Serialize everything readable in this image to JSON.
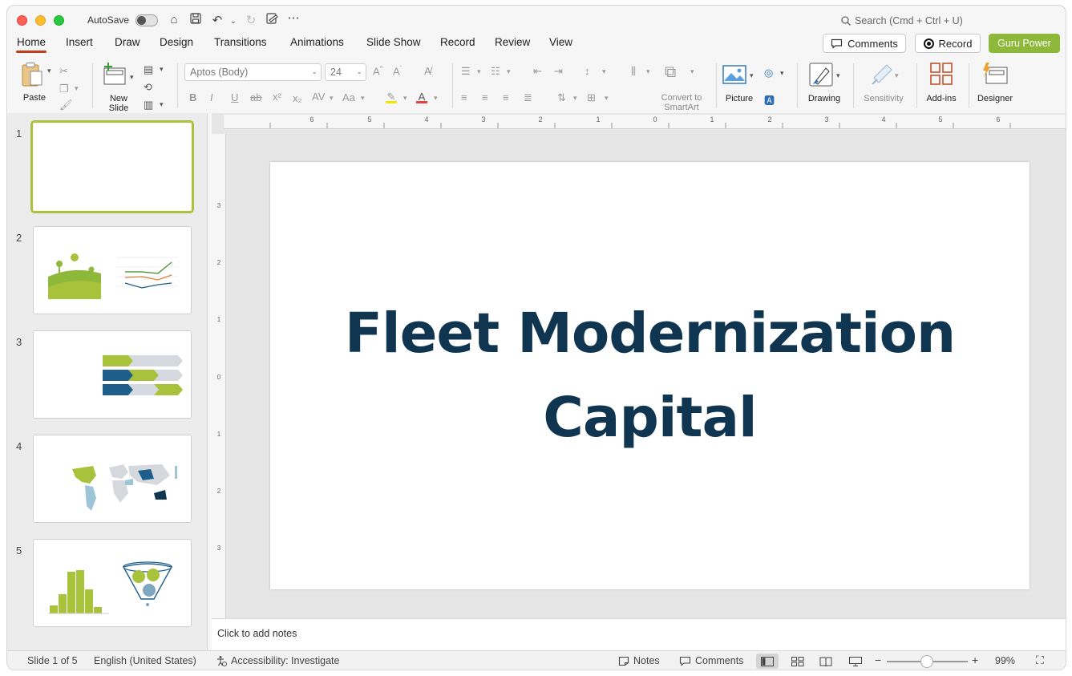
{
  "titlebar": {
    "autosave_label": "AutoSave",
    "search_placeholder": "Search (Cmd + Ctrl + U)"
  },
  "tabs": [
    "Home",
    "Insert",
    "Draw",
    "Design",
    "Transitions",
    "Animations",
    "Slide Show",
    "Record",
    "Review",
    "View"
  ],
  "header_buttons": {
    "comments": "Comments",
    "record": "Record",
    "guru": "Guru Power"
  },
  "ribbon": {
    "paste": "Paste",
    "new_slide": "New\nSlide",
    "font_name": "Aptos (Body)",
    "font_size": "24",
    "convert_smartart": "Convert to\nSmartArt",
    "picture": "Picture",
    "drawing": "Drawing",
    "sensitivity": "Sensitivity",
    "addins": "Add-ins",
    "designer": "Designer"
  },
  "thumbnails": [
    {
      "num": "1"
    },
    {
      "num": "2"
    },
    {
      "num": "3"
    },
    {
      "num": "4"
    },
    {
      "num": "5"
    }
  ],
  "slide": {
    "title_line1": "Fleet Modernization",
    "title_line2": "Capital"
  },
  "notes_placeholder": "Click to add notes",
  "statusbar": {
    "slide_of": "Slide 1 of 5",
    "language": "English (United States)",
    "accessibility": "Accessibility: Investigate",
    "notes": "Notes",
    "comments": "Comments",
    "zoom": "99%"
  },
  "colors": {
    "title": "#0f3550",
    "accent_green": "#8db83a",
    "active_tab_underline": "#c43e1c"
  }
}
